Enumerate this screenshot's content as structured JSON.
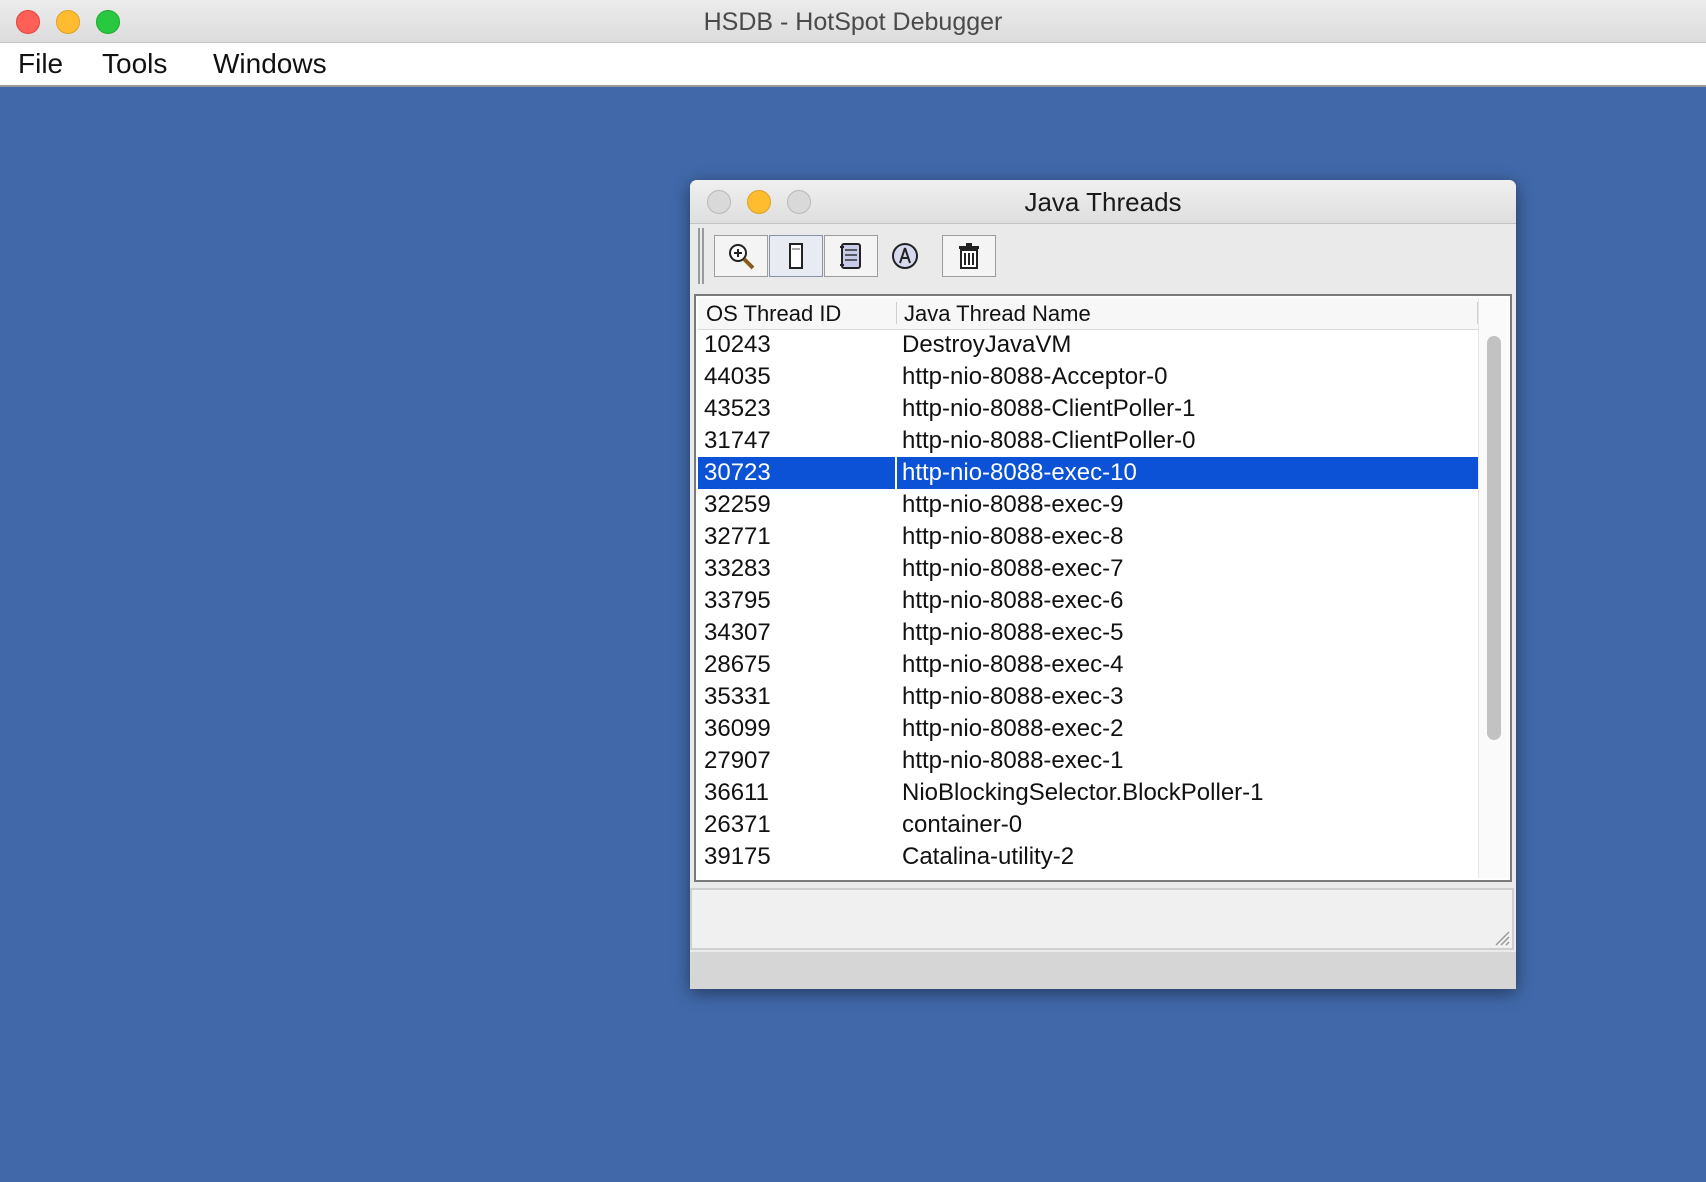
{
  "window": {
    "title": "HSDB - HotSpot Debugger",
    "traffic_light_colors": {
      "close": "#fe5f57",
      "minimize": "#febc2e",
      "zoom": "#28c840"
    }
  },
  "menubar": {
    "items": [
      {
        "label": "File"
      },
      {
        "label": "Tools"
      },
      {
        "label": "Windows"
      }
    ]
  },
  "desktop": {
    "background": "#4169aa"
  },
  "java_threads": {
    "title": "Java Threads",
    "toolbar": {
      "buttons": [
        {
          "icon": "zoom-inspect-icon"
        },
        {
          "icon": "stack-memory-icon"
        },
        {
          "icon": "stack-trace-icon"
        },
        {
          "icon": "thread-info-icon"
        },
        {
          "icon": "trash-icon"
        }
      ]
    },
    "table": {
      "columns": [
        "OS Thread ID",
        "Java Thread Name"
      ],
      "selected_row_index": 4,
      "selection_color": "#0b52d6",
      "rows": [
        {
          "id": "10243",
          "name": "DestroyJavaVM"
        },
        {
          "id": "44035",
          "name": "http-nio-8088-Acceptor-0"
        },
        {
          "id": "43523",
          "name": "http-nio-8088-ClientPoller-1"
        },
        {
          "id": "31747",
          "name": "http-nio-8088-ClientPoller-0"
        },
        {
          "id": "30723",
          "name": "http-nio-8088-exec-10"
        },
        {
          "id": "32259",
          "name": "http-nio-8088-exec-9"
        },
        {
          "id": "32771",
          "name": "http-nio-8088-exec-8"
        },
        {
          "id": "33283",
          "name": "http-nio-8088-exec-7"
        },
        {
          "id": "33795",
          "name": "http-nio-8088-exec-6"
        },
        {
          "id": "34307",
          "name": "http-nio-8088-exec-5"
        },
        {
          "id": "28675",
          "name": "http-nio-8088-exec-4"
        },
        {
          "id": "35331",
          "name": "http-nio-8088-exec-3"
        },
        {
          "id": "36099",
          "name": "http-nio-8088-exec-2"
        },
        {
          "id": "27907",
          "name": "http-nio-8088-exec-1"
        },
        {
          "id": "36611",
          "name": "NioBlockingSelector.BlockPoller-1"
        },
        {
          "id": "26371",
          "name": "container-0"
        },
        {
          "id": "39175",
          "name": "Catalina-utility-2"
        }
      ]
    }
  }
}
